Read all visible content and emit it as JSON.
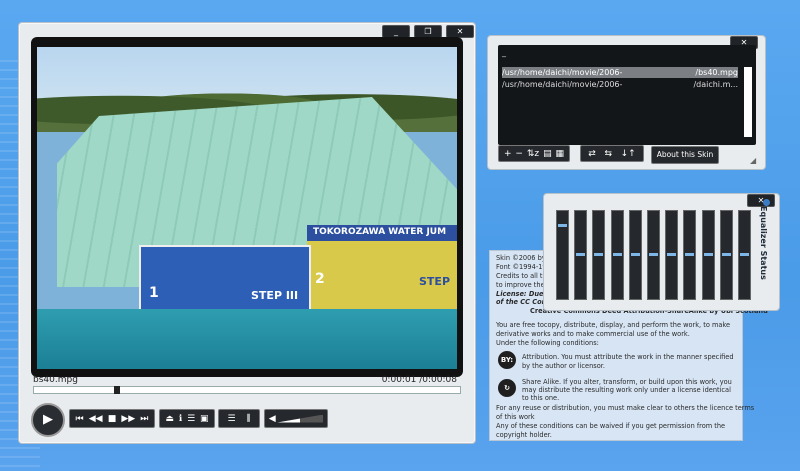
{
  "player": {
    "window_buttons": [
      "_",
      "❐",
      "✕"
    ],
    "filename": "bs40.mpg",
    "timecode": "0:00:01 /0:00:08",
    "progress": 0.19,
    "video_text": {
      "banner_top": "TOKOROZAWA WATER JUM",
      "step_left": "STEP III",
      "num_left": "1",
      "num_right": "2",
      "step_right": "STEP"
    },
    "controls": {
      "play": "▶",
      "transport": [
        "⏮",
        "◀◀",
        "■",
        "▶▶",
        "⏭"
      ],
      "misc": [
        "⏏",
        "ℹ",
        "☰",
        "▣"
      ],
      "view": [
        "☰",
        "⫼"
      ]
    },
    "volume": 0.5
  },
  "playlist": {
    "title": "_",
    "rows": [
      {
        "path": "/usr/home/daichi/movie/2006-",
        "file": "/bs40.mpg",
        "selected": true
      },
      {
        "path": "/usr/home/daichi/movie/2006-",
        "file": "/daichi.m...",
        "selected": false
      }
    ],
    "buttons_left": [
      "+",
      "−",
      "⇅z",
      "▤",
      "▦"
    ],
    "buttons_right": [
      "⇄",
      "⇆",
      "↓↑"
    ],
    "about_label": "About this Skin",
    "close": "✕",
    "resize": "◢"
  },
  "license": {
    "lines": [
      "Skin ©2006 by daichi",
      "Font ©1994-1996 ...",
      "Credits to all the...",
      "to improve the skin",
      "License: Due to ...",
      "of the CC Commons ...",
      "Creative Commons Deed Attribution-ShareAlike by Ubi Scotland",
      "You are free tocopy, distribute, display, and perform the work, to make",
      "derivative works and to make commercial use of the work.",
      "Under the following conditions:",
      "Attribution. You must attribute the work in the manner specified",
      "by the author or licensor.",
      "Share Alike. If you alter, transform, or build upon this work, you",
      "may distribute the resulting work only under a license identical",
      "to this one.",
      "For any reuse or distribution, you must make clear to others the licence terms",
      "of this work",
      "Any of these conditions can be waived if you get permission from the",
      "copyright holder."
    ],
    "badge_by": "BY:",
    "badge_sa": "↻"
  },
  "equalizer": {
    "title": "Equalizer Status",
    "close": "✕",
    "bands": [
      0.15,
      0.5,
      0.5,
      0.5,
      0.5,
      0.5,
      0.5,
      0.5,
      0.5,
      0.5,
      0.5
    ]
  },
  "colors": {
    "accent": "#7fb6e8",
    "background": "#4a9be8",
    "panel": "#e9ecef",
    "control": "#25282c"
  }
}
